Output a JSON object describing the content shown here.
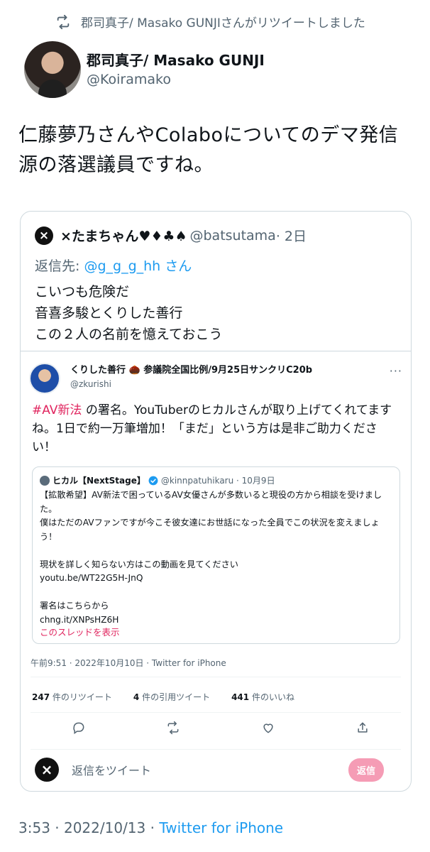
{
  "retweet_banner": {
    "text": "郡司真子/ Masako GUNJIさんがリツイートしました"
  },
  "author": {
    "name": "郡司真子/ Masako GUNJI",
    "handle": "@Koiramako"
  },
  "tweet": {
    "text": "仁藤夢乃さんやColaboについてのデマ発信源の落選議員ですね。"
  },
  "quoted": {
    "avatar_letter": "×",
    "name": "×たまちゃん♥♦♣♠",
    "handle": "@batsutama",
    "time": "· 2日",
    "reply_prefix": "返信先: ",
    "reply_mention": "@g_g_g_hh",
    "reply_suffix": " さん",
    "body": "こいつも危険だ\n音喜多駿とくりした善行\nこの２人の名前を憶えておこう",
    "screenshot": {
      "name": "くりした善行 🌰 参議院全国比例/9月25日サンクリC20b",
      "handle": "@zkurishi",
      "more": "···",
      "hashtag": "#AV新法",
      "text": " の署名。YouTuberのヒカルさんが取り上げてくれてますね。1日で約一万筆増加！「まだ」という方は是非ご助力ください！",
      "inner": {
        "name": "ヒカル【NextStage】",
        "handle": "@kinnpatuhikaru · 10月9日",
        "body": "【拡散希望】AV新法で困っているAV女優さんが多数いると現役の方から相談を受けました。\n僕はただのAVファンですが今こそ彼女達にお世話になった全員でこの状況を変えましょう！\n\n現状を詳しく知らない方はこの動画を見てください\nyoutu.be/WT22G5H-JnQ\n\n署名はこちらから\nchng.it/XNPsHZ6H",
        "show_thread": "このスレッドを表示"
      },
      "meta": "午前9:51 · 2022年10月10日 · Twitter for iPhone",
      "stats": [
        {
          "count": "247",
          "label": " 件のリツイート"
        },
        {
          "count": "4",
          "label": " 件の引用ツイート"
        },
        {
          "count": "441",
          "label": " 件のいいね"
        }
      ],
      "reply_avatar_letter": "×",
      "reply_placeholder": "返信をツイート",
      "reply_button": "返信"
    }
  },
  "footer": {
    "time": "3:53 · 2022/10/13 · ",
    "source": "Twitter for iPhone"
  },
  "colors": {
    "link": "#1d9bf0",
    "hashtag": "#e0245e",
    "muted": "#536471"
  }
}
